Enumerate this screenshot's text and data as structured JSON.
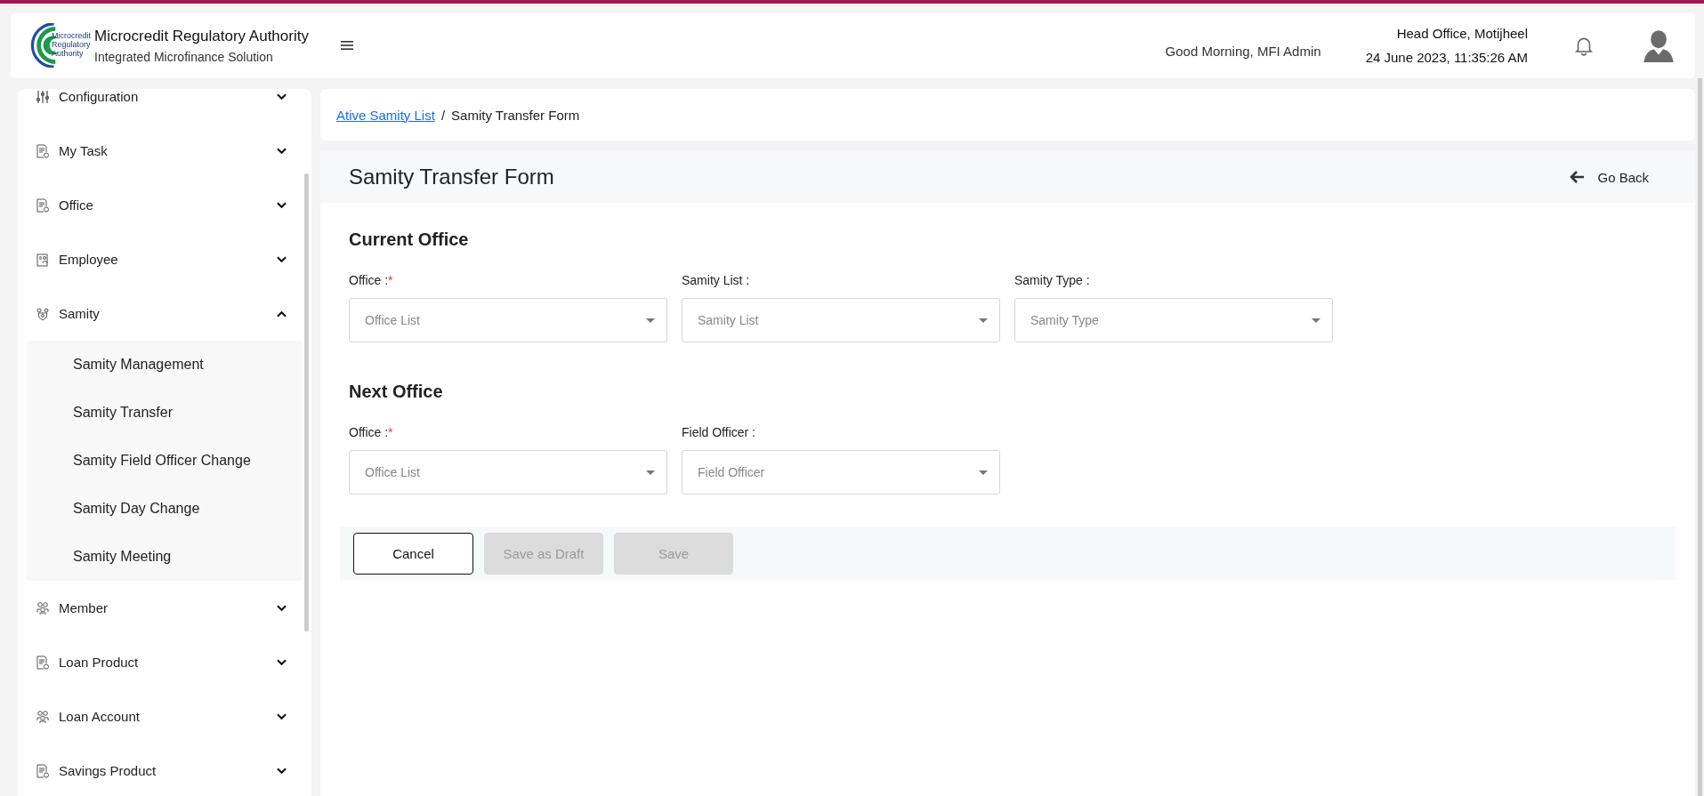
{
  "header": {
    "logo_text": [
      "Microcredit",
      "Regulatory",
      "Authority"
    ],
    "title": "Microcredit Regulatory Authority",
    "subtitle": "Integrated Microfinance Solution",
    "greeting": "Good Morning, MFI Admin",
    "office": "Head Office, Motijheel",
    "datetime": "24 June 2023, 11:35:26 AM"
  },
  "sidebar": {
    "items": [
      {
        "label": "Configuration",
        "kind": "sliders",
        "expanded": false
      },
      {
        "label": "My Task",
        "kind": "doc",
        "expanded": false
      },
      {
        "label": "Office",
        "kind": "doc",
        "expanded": false
      },
      {
        "label": "Employee",
        "kind": "badge",
        "expanded": false
      },
      {
        "label": "Samity",
        "kind": "group",
        "expanded": true,
        "children": [
          {
            "label": "Samity Management"
          },
          {
            "label": "Samity Transfer"
          },
          {
            "label": "Samity Field Officer Change"
          },
          {
            "label": "Samity Day Change"
          },
          {
            "label": "Samity Meeting"
          }
        ]
      },
      {
        "label": "Member",
        "kind": "people",
        "expanded": false
      },
      {
        "label": "Loan Product",
        "kind": "doc",
        "expanded": false
      },
      {
        "label": "Loan Account",
        "kind": "people",
        "expanded": false
      },
      {
        "label": "Savings Product",
        "kind": "doc",
        "expanded": false
      }
    ]
  },
  "breadcrumb": {
    "link": "Ative Samity List",
    "separator": "/",
    "current": "Samity Transfer Form"
  },
  "page": {
    "title": "Samity Transfer Form",
    "back": "Go Back"
  },
  "sections": [
    {
      "title": "Current Office",
      "fields": [
        {
          "label": "Office :",
          "required": true,
          "placeholder": "Office List"
        },
        {
          "label": "Samity List :",
          "required": false,
          "placeholder": "Samity List"
        },
        {
          "label": "Samity Type :",
          "required": false,
          "placeholder": "Samity Type"
        }
      ]
    },
    {
      "title": "Next Office",
      "fields": [
        {
          "label": "Office :",
          "required": true,
          "placeholder": "Office List"
        },
        {
          "label": "Field Officer :",
          "required": false,
          "placeholder": "Field Officer"
        }
      ]
    }
  ],
  "buttons": [
    {
      "label": "Cancel",
      "disabled": false
    },
    {
      "label": "Save as Draft",
      "disabled": true
    },
    {
      "label": "Save",
      "disabled": true
    }
  ],
  "required_mark": "*"
}
